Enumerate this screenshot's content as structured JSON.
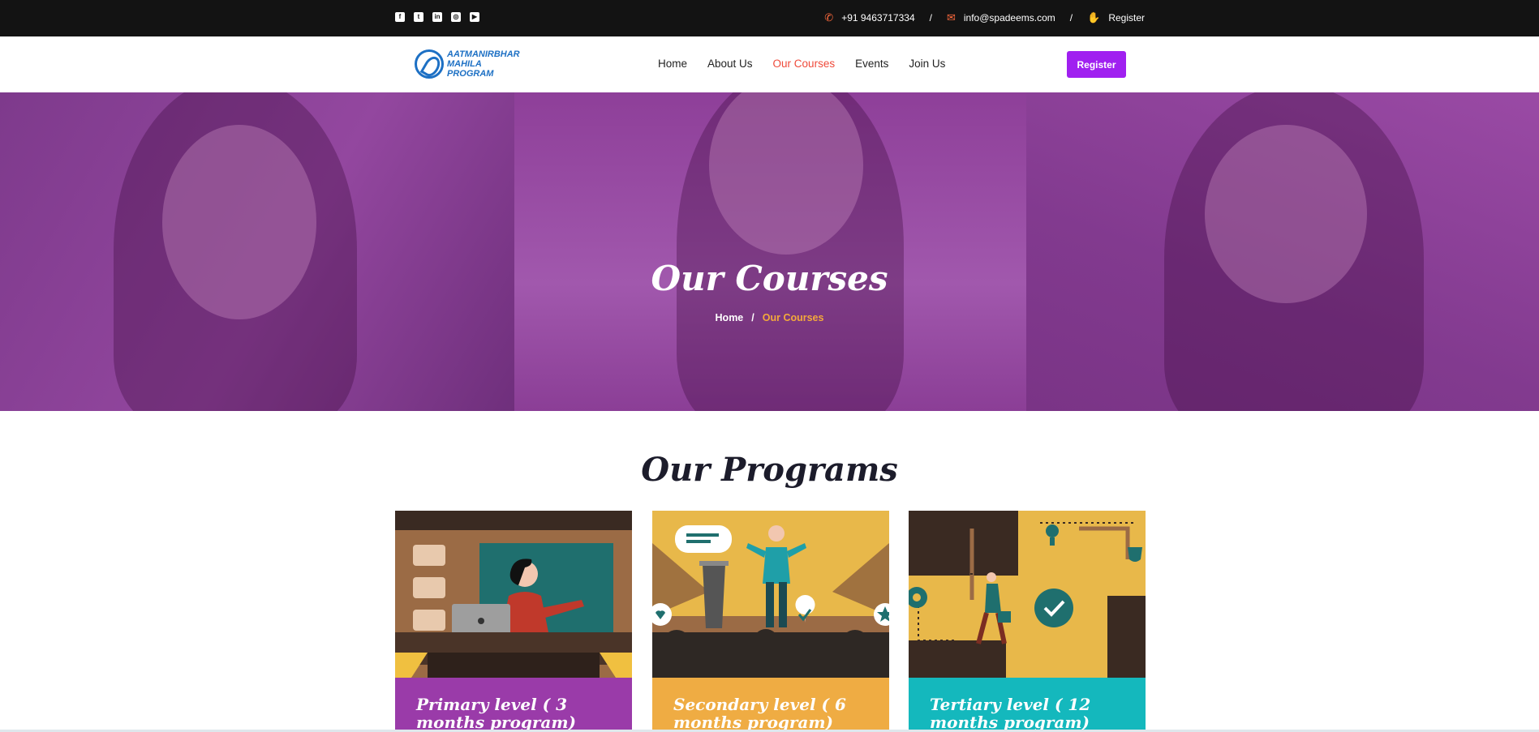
{
  "topbar": {
    "social_icons": [
      "facebook-icon",
      "twitter-icon",
      "linkedin-icon",
      "instagram-icon",
      "youtube-icon"
    ],
    "phone": "+91 9463717334",
    "email": "info@spadeems.com",
    "register": "Register",
    "separator": "/"
  },
  "navbar": {
    "logo_lines": [
      "AATMANIRBHAR",
      "MAHILA",
      "PROGRAM"
    ],
    "items": [
      {
        "label": "Home",
        "active": false
      },
      {
        "label": "About Us",
        "active": false
      },
      {
        "label": "Our Courses",
        "active": true
      },
      {
        "label": "Events",
        "active": false
      },
      {
        "label": "Join Us",
        "active": false
      }
    ],
    "register_button": "Register"
  },
  "hero": {
    "title": "Our Courses",
    "breadcrumb_home": "Home",
    "breadcrumb_sep": "/",
    "breadcrumb_current": "Our Courses"
  },
  "programs": {
    "title": "Our Programs",
    "cards": [
      {
        "label": "Primary level ( 3 months program)"
      },
      {
        "label": "Secondary level ( 6 months program)"
      },
      {
        "label": "Tertiary level ( 12 months program)"
      }
    ]
  },
  "colors": {
    "accent": "#a020f0",
    "active_nav": "#ef4a3a",
    "breadcrumb_current": "#f3a93b",
    "hero_overlay": "#8c3f9b",
    "card1": "#9a3ba9",
    "card2": "#efac43",
    "card3": "#14b8bd"
  }
}
